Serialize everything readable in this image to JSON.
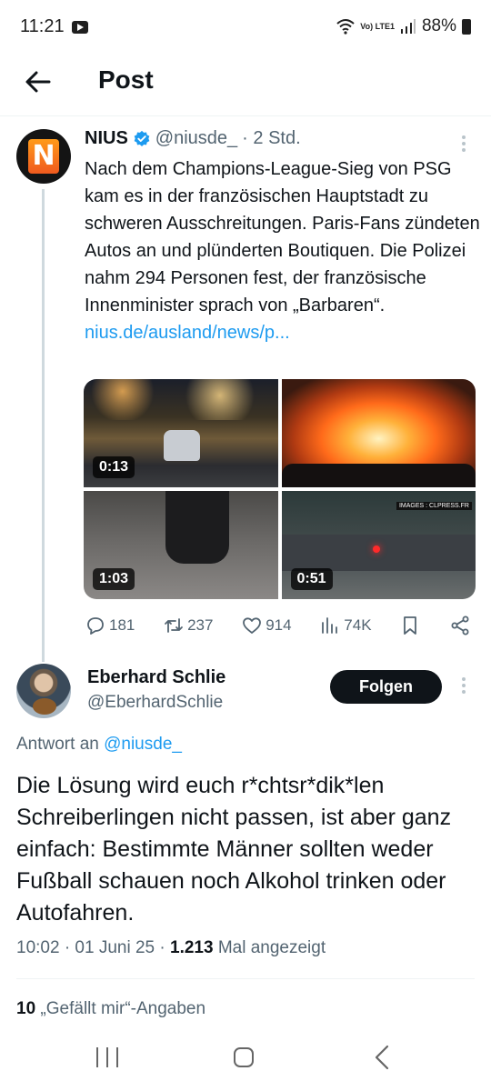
{
  "status_bar": {
    "time": "11:21",
    "network": "Vo) LTE1",
    "battery": "88%"
  },
  "top_bar": {
    "title": "Post"
  },
  "parent_tweet": {
    "author": "NIUS",
    "avatar_letter": "N",
    "handle": "@niusde_",
    "time": "· 2 Std.",
    "text": "Nach dem Champions-League-Sieg von PSG kam es in der französischen Hauptstadt zu schweren Ausschreitungen. Paris-Fans zündeten Autos an und plünderten Boutiquen. Die Polizei nahm 294 Personen fest, der französische Innenminister sprach von „Barbaren“. ",
    "link": "nius.de/ausland/news/p...",
    "media": [
      {
        "duration": "0:13"
      },
      {
        "duration": ""
      },
      {
        "duration": "1:03"
      },
      {
        "duration": "0:51",
        "watermark": "IMAGES : CLPRESS.FR"
      }
    ],
    "stats": {
      "replies": "181",
      "reposts": "237",
      "likes": "914",
      "views": "74K"
    }
  },
  "reply": {
    "name": "Eberhard Schlie",
    "handle": "@EberhardSchlie",
    "follow_label": "Folgen",
    "reply_to_prefix": "Antwort an",
    "reply_to_handle": "@niusde_",
    "text": "Die Lösung wird euch r*chtsr*dik*len Schreiberlingen nicht passen, ist aber ganz einfach: Bestimmte Männer sollten weder Fußball schauen noch Alkohol trinken oder Autofahren.",
    "timestamp": "10:02 · 01 Juni 25 · ",
    "views_count": "1.213",
    "views_label": " Mal angezeigt",
    "likes_count": "10",
    "likes_label": " „Gefällt mir“-Angaben"
  },
  "colors": {
    "accent": "#1d9bf0",
    "text": "#0f1419",
    "secondary": "#536471",
    "follow_button": "#0f1419"
  }
}
